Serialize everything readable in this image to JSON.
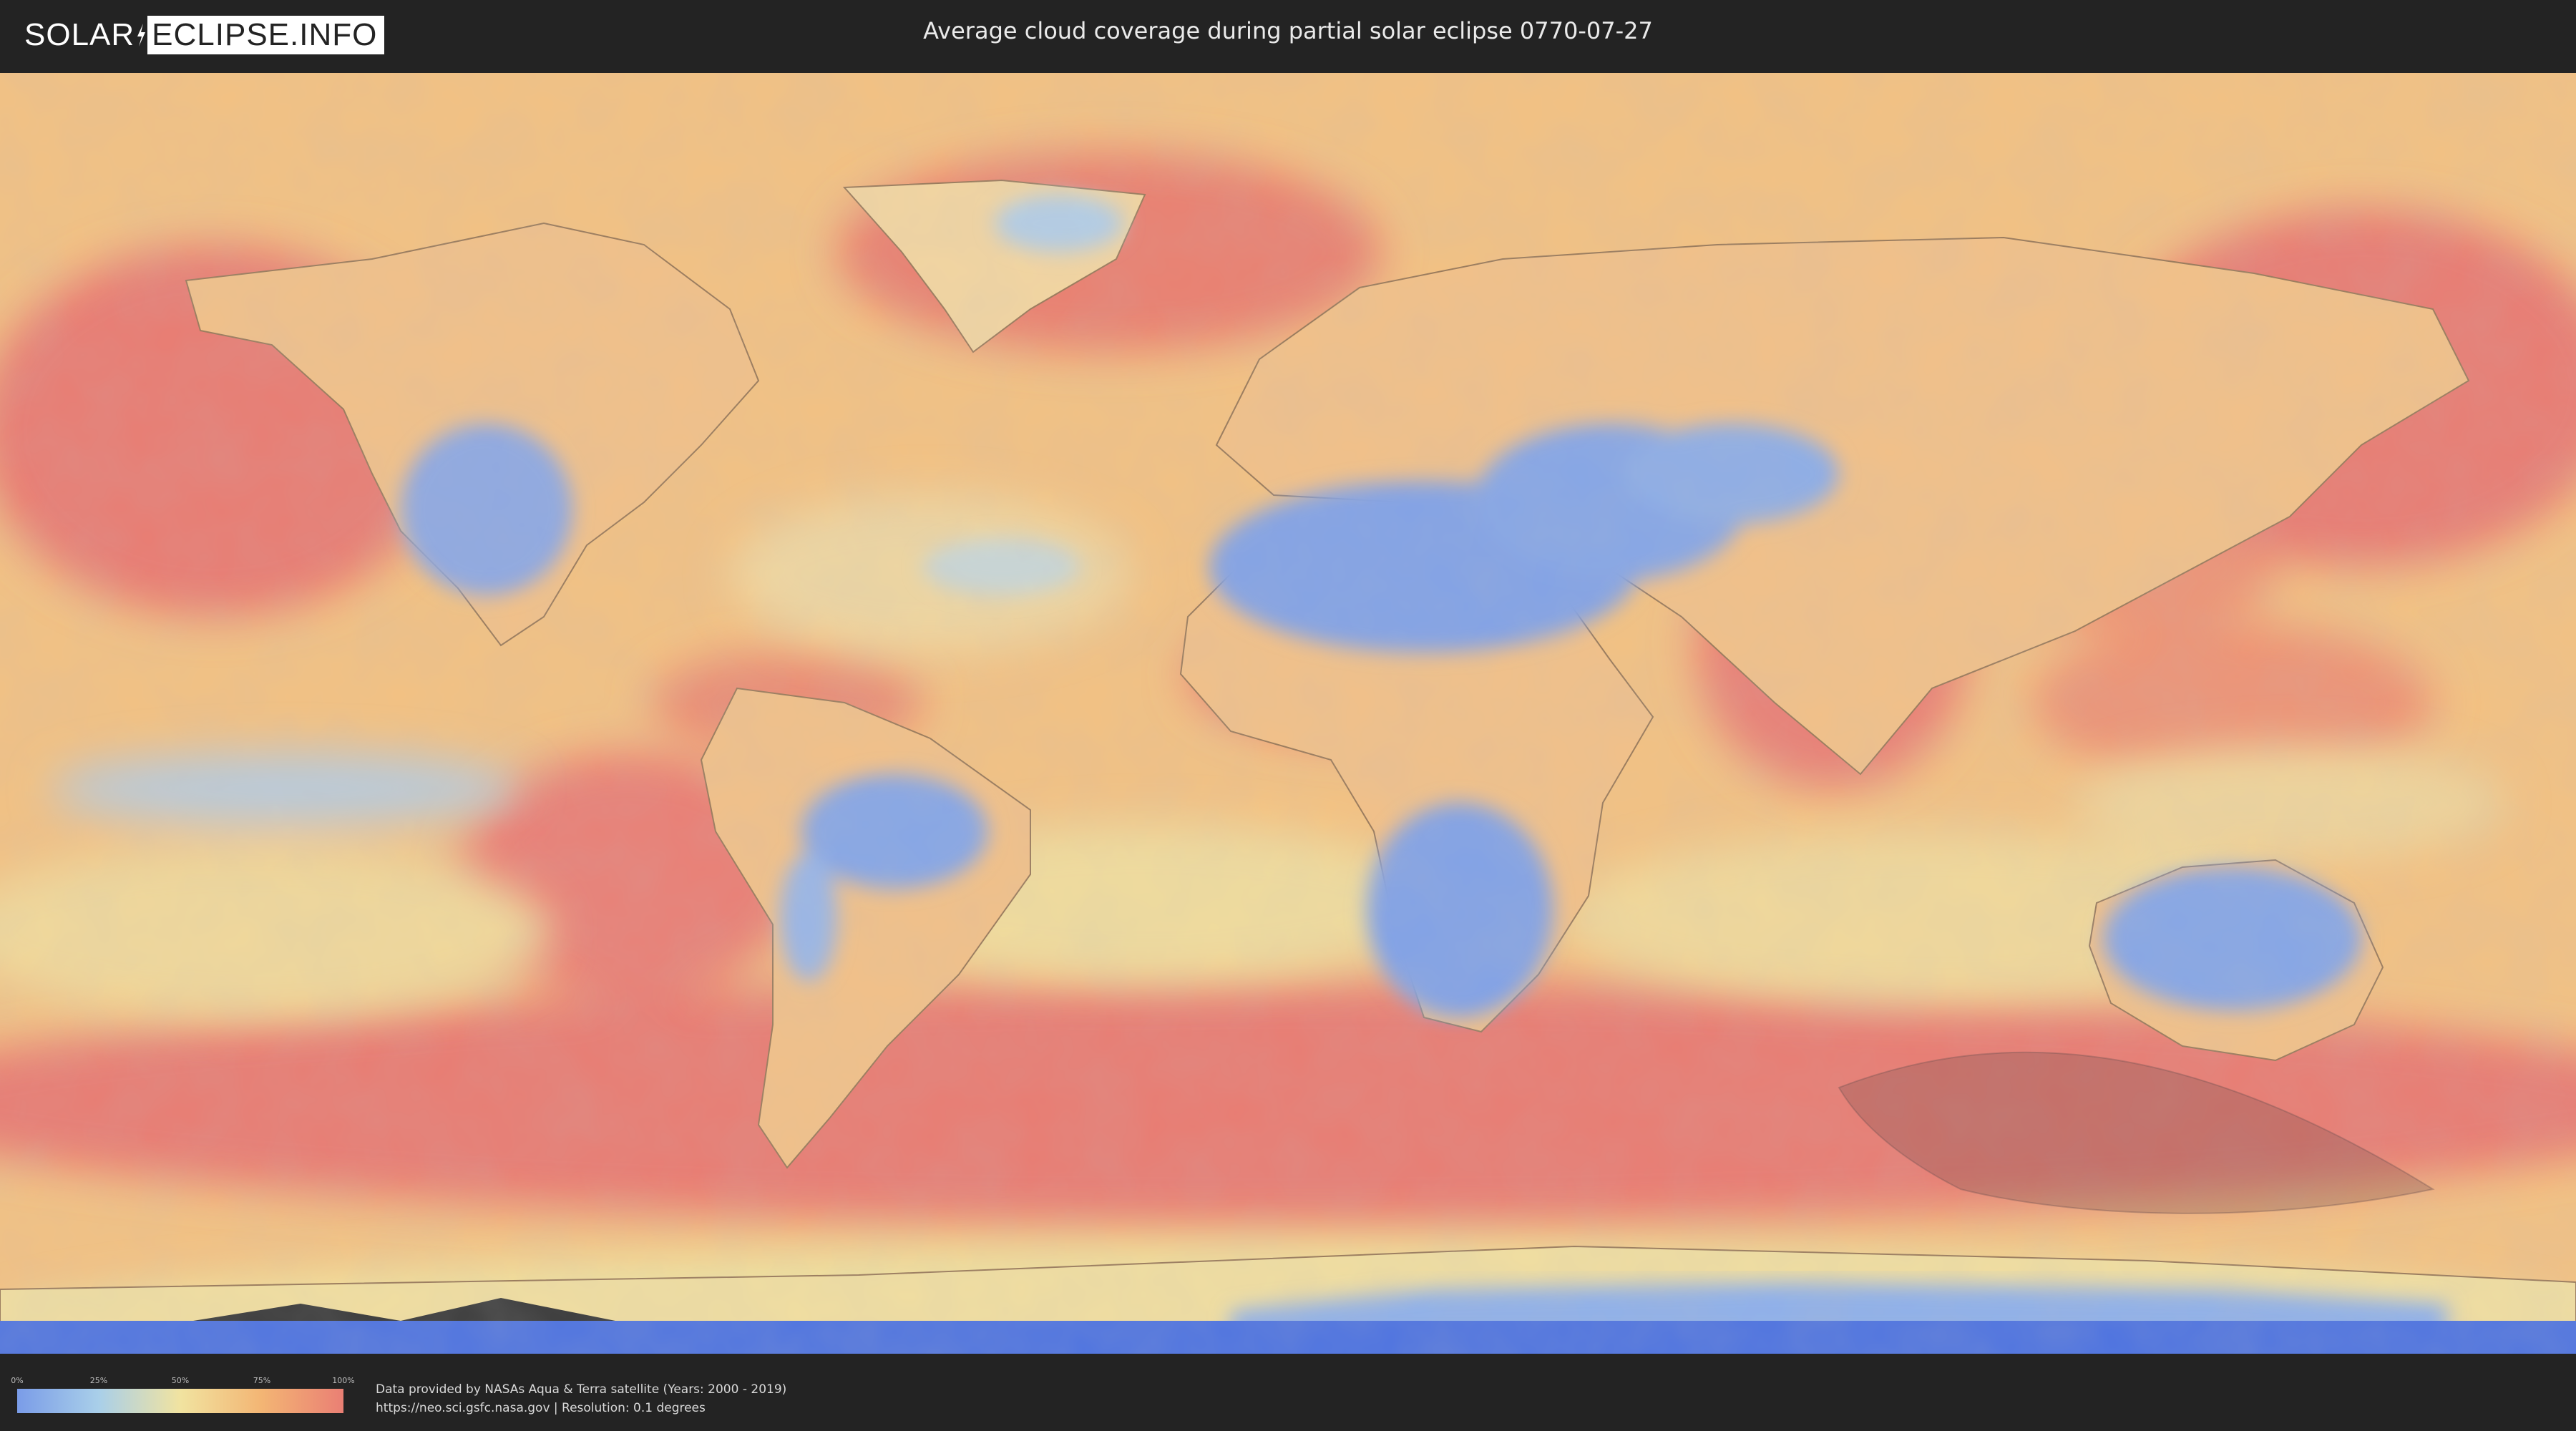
{
  "header": {
    "logo_part1": "SOLAR",
    "logo_part2": "ECLIPSE.INFO",
    "title": "Average cloud coverage during partial solar eclipse 0770-07-27"
  },
  "map": {
    "palette": {
      "clear": "#7a9ce8",
      "low": "#a9cfe9",
      "mid": "#f1e3a0",
      "high": "#f3b574",
      "overcast": "#ea7f74",
      "polar_ice": "#4a6fe0",
      "border_line": "#8a6a55",
      "eclipse_shadow": "#6e4f4f"
    },
    "icons": {
      "eclipse_path": "eclipse-shadow-overlay"
    }
  },
  "legend": {
    "ticks": [
      "0%",
      "25%",
      "50%",
      "75%",
      "100%"
    ]
  },
  "footer": {
    "credit_line1": "Data provided by NASAs Aqua & Terra satellite (Years: 2000 - 2019)",
    "credit_line2": "https://neo.sci.gsfc.nasa.gov | Resolution: 0.1 degrees"
  }
}
